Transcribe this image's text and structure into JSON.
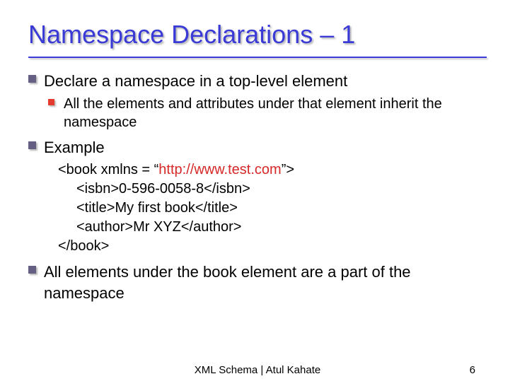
{
  "title": "Namespace Declarations – 1",
  "bullets": {
    "b1": "Declare a namespace in a top-level element",
    "b1_sub1": "All the elements and attributes under that element inherit the namespace",
    "b2": "Example",
    "b3": "All elements under the book element are a part of the namespace"
  },
  "example": {
    "line1_pre": "<book xmlns = “",
    "line1_url": "http://www.test.com",
    "line1_post": "”>",
    "line2": "<isbn>0-596-0058-8</isbn>",
    "line3": "<title>My first book</title>",
    "line4": "<author>Mr XYZ</author>",
    "line5": "</book>"
  },
  "footer": "XML Schema | Atul Kahate",
  "page_number": "6"
}
